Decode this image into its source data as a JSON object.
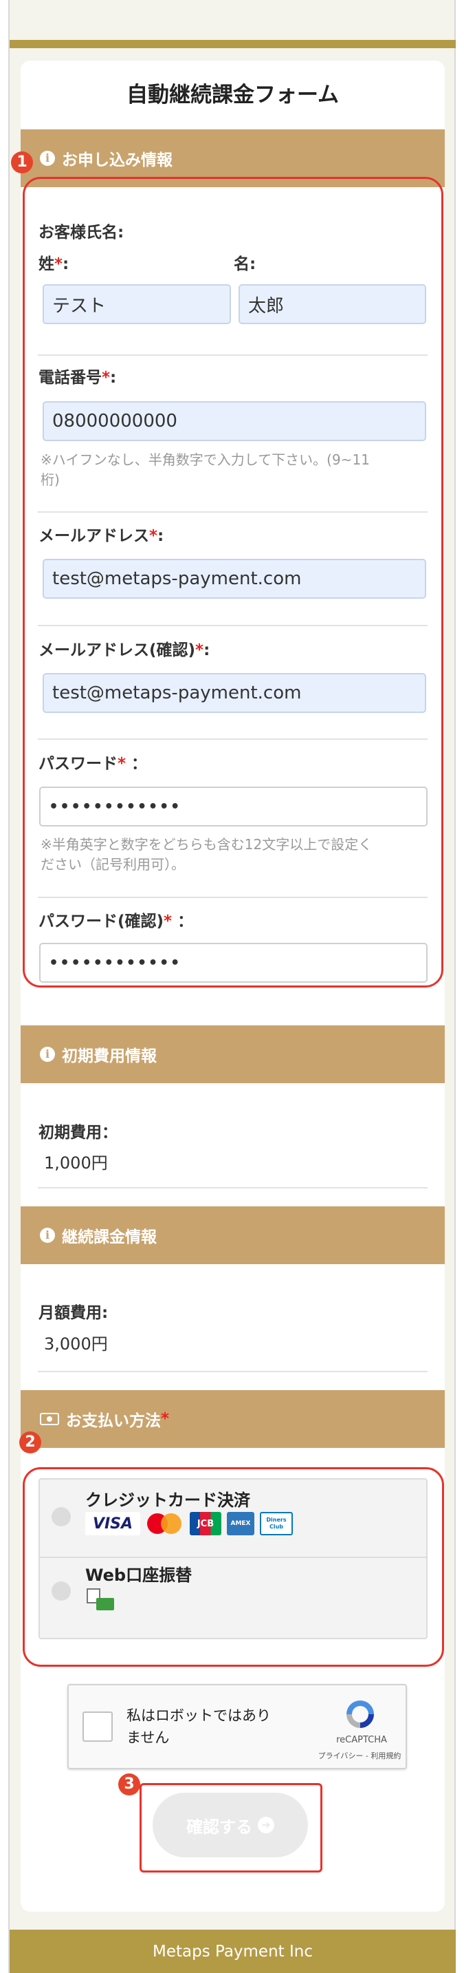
{
  "title": "自動継続課金フォーム",
  "sections": {
    "application": "お申し込み情報",
    "initial_fee": "初期費用情報",
    "recurring": "継続課金情報",
    "payment": "お支払い方法"
  },
  "annotations": [
    "1",
    "2",
    "3"
  ],
  "required_mark": "*",
  "form": {
    "name_label": "お客様氏名:",
    "last_name_label": "姓",
    "first_name_label": "名:",
    "last_name_value": "テスト",
    "first_name_value": "太郎",
    "phone_label": "電話番号",
    "phone_value": "08000000000",
    "phone_hint_1": "※ハイフンなし、半角数字で入力して下さい。(9~11",
    "phone_hint_2": "桁)",
    "email_label": "メールアドレス",
    "email_value": "test@metaps-payment.com",
    "email_confirm_label": "メールアドレス(確認)",
    "email_confirm_value": "test@metaps-payment.com",
    "password_label": "パスワード",
    "password_value": "••••••••••••",
    "password_hint_1": "※半角英字と数字をどちらも含む12文字以上で設定く",
    "password_hint_2": "ださい（記号利用可）。",
    "password_confirm_label": "パスワード(確認)",
    "password_confirm_value": "••••••••••••",
    "colon": ":",
    "colon_spaced": "："
  },
  "initial_fee": {
    "label": "初期費用：",
    "value": "1,000円"
  },
  "recurring": {
    "label": "月額費用:",
    "value": "3,000円"
  },
  "payment": {
    "options": [
      {
        "label": "クレジットカード決済",
        "logos": [
          "VISA",
          "Mastercard",
          "JCB",
          "AMEX",
          "Diners Club"
        ]
      },
      {
        "label": "Web口座振替"
      }
    ]
  },
  "captcha": {
    "text_1": "私はロボットではあり",
    "text_2": "ません",
    "brand": "reCAPTCHA",
    "links": "プライバシー - 利用規約"
  },
  "confirm_button": "確認する",
  "footer": "Metaps Payment Inc",
  "colors": {
    "accent": "#b39a45",
    "section": "#c9a36e",
    "required": "#e8241c",
    "annotation": "#e8322a"
  }
}
